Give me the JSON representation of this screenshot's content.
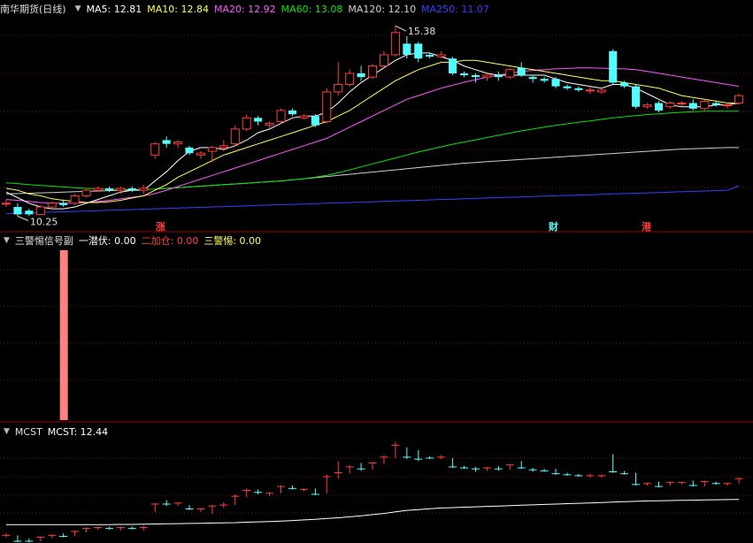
{
  "colors": {
    "up": "#ff3c3c",
    "down": "#54ffff",
    "ma5": "#ffffff",
    "ma10": "#ffff54",
    "ma20": "#ff54ff",
    "ma60": "#00e600",
    "ma120": "#d0d0d0",
    "ma250": "#3c3cff",
    "grid": "#7a0a0a",
    "border": "#a00000",
    "signal": "#ff8080",
    "mcst": "#ffffff"
  },
  "main_legend": {
    "title": "南华期货(日线)",
    "items": [
      {
        "text": "MA5: 12.81",
        "color": "#ffffff"
      },
      {
        "text": "MA10: 12.84",
        "color": "#ffff54"
      },
      {
        "text": "MA20: 12.92",
        "color": "#ff54ff"
      },
      {
        "text": "MA60: 13.08",
        "color": "#00e600"
      },
      {
        "text": "MA120: 12.10",
        "color": "#d0d0d0"
      },
      {
        "text": "MA250: 11.07",
        "color": "#3c3cff"
      }
    ]
  },
  "sub1_legend": {
    "title": "三警惕信号副",
    "items": [
      {
        "text": "一潜伏: 0.00",
        "color": "#ffffff"
      },
      {
        "text": "二加仓: 0.00",
        "color": "#ff3c3c"
      },
      {
        "text": "三警惕: 0.00",
        "color": "#ffff54"
      }
    ]
  },
  "sub2_legend": {
    "title": "MCST",
    "items": [
      {
        "text": "MCST: 12.44",
        "color": "#ffffff"
      }
    ]
  },
  "markers": {
    "zhang": "涨",
    "cai": "财",
    "gang": "港"
  },
  "annotations": {
    "high": "15.38",
    "low": "10.25"
  },
  "chart_data": {
    "type": "candlestick",
    "price_range": [
      10.0,
      15.6
    ],
    "candles": [
      [
        10.6,
        10.6,
        10.5,
        10.7
      ],
      [
        10.5,
        10.3,
        10.25,
        10.6
      ],
      [
        10.4,
        10.3,
        10.25,
        10.45
      ],
      [
        10.3,
        10.5,
        10.3,
        10.55
      ],
      [
        10.5,
        10.6,
        10.45,
        10.65
      ],
      [
        10.6,
        10.55,
        10.5,
        10.7
      ],
      [
        10.6,
        10.8,
        10.55,
        10.85
      ],
      [
        10.8,
        10.95,
        10.75,
        11.0
      ],
      [
        10.95,
        11.0,
        10.9,
        11.05
      ],
      [
        11.0,
        10.95,
        10.9,
        11.05
      ],
      [
        10.95,
        11.0,
        10.85,
        11.05
      ],
      [
        11.0,
        10.95,
        10.9,
        11.05
      ],
      [
        10.95,
        11.0,
        10.85,
        11.1
      ],
      [
        11.9,
        12.2,
        11.8,
        12.25
      ],
      [
        12.3,
        12.2,
        12.1,
        12.4
      ],
      [
        12.2,
        12.25,
        12.1,
        12.3
      ],
      [
        12.1,
        11.95,
        11.9,
        12.15
      ],
      [
        11.9,
        11.95,
        11.8,
        12.0
      ],
      [
        12.0,
        12.1,
        11.7,
        12.15
      ],
      [
        12.1,
        12.15,
        12.0,
        12.3
      ],
      [
        12.2,
        12.6,
        12.15,
        12.7
      ],
      [
        12.6,
        12.9,
        12.55,
        13.0
      ],
      [
        12.9,
        12.8,
        12.7,
        12.95
      ],
      [
        12.7,
        12.75,
        12.6,
        12.8
      ],
      [
        12.8,
        13.1,
        12.75,
        13.15
      ],
      [
        13.1,
        13.0,
        12.95,
        13.15
      ],
      [
        12.9,
        12.95,
        12.85,
        13.0
      ],
      [
        12.95,
        12.7,
        12.65,
        13.0
      ],
      [
        12.8,
        13.6,
        12.75,
        13.7
      ],
      [
        13.6,
        13.8,
        13.5,
        14.4
      ],
      [
        13.8,
        14.1,
        13.75,
        14.2
      ],
      [
        14.1,
        14.0,
        13.9,
        14.3
      ],
      [
        14.0,
        14.3,
        13.95,
        14.35
      ],
      [
        14.3,
        14.6,
        14.25,
        14.7
      ],
      [
        14.6,
        15.2,
        14.55,
        15.38
      ],
      [
        14.9,
        14.6,
        14.5,
        15.1
      ],
      [
        14.9,
        14.5,
        14.4,
        14.95
      ],
      [
        14.6,
        14.55,
        14.5,
        14.65
      ],
      [
        14.55,
        14.6,
        14.5,
        14.7
      ],
      [
        14.5,
        14.1,
        14.05,
        14.55
      ],
      [
        14.1,
        14.05,
        14.0,
        14.15
      ],
      [
        14.05,
        14.0,
        13.85,
        14.1
      ],
      [
        14.0,
        14.05,
        13.9,
        14.1
      ],
      [
        14.05,
        14.0,
        13.9,
        14.15
      ],
      [
        14.0,
        14.2,
        13.95,
        14.25
      ],
      [
        14.25,
        14.05,
        14.0,
        14.4
      ],
      [
        14.0,
        13.95,
        13.85,
        14.05
      ],
      [
        13.95,
        13.9,
        13.85,
        14.0
      ],
      [
        13.95,
        13.75,
        13.7,
        14.0
      ],
      [
        13.75,
        13.7,
        13.65,
        13.8
      ],
      [
        13.7,
        13.65,
        13.6,
        13.75
      ],
      [
        13.65,
        13.65,
        13.55,
        13.75
      ],
      [
        13.6,
        13.65,
        13.55,
        13.7
      ],
      [
        14.7,
        13.85,
        13.8,
        14.75
      ],
      [
        13.85,
        13.75,
        13.7,
        13.9
      ],
      [
        13.75,
        13.2,
        13.15,
        13.8
      ],
      [
        13.2,
        13.25,
        13.15,
        13.3
      ],
      [
        13.3,
        13.1,
        13.05,
        13.35
      ],
      [
        13.2,
        13.3,
        13.15,
        13.35
      ],
      [
        13.3,
        13.3,
        13.2,
        13.35
      ],
      [
        13.3,
        13.15,
        13.1,
        13.4
      ],
      [
        13.15,
        13.35,
        13.1,
        13.4
      ],
      [
        13.3,
        13.25,
        13.2,
        13.35
      ],
      [
        13.25,
        13.25,
        13.15,
        13.3
      ],
      [
        13.3,
        13.5,
        13.25,
        13.55
      ]
    ],
    "ma": {
      "ma5": [
        10.9,
        10.75,
        10.6,
        10.5,
        10.45,
        10.45,
        10.5,
        10.6,
        10.7,
        10.8,
        10.9,
        10.95,
        10.95,
        11.2,
        11.45,
        11.75,
        12.0,
        12.1,
        12.1,
        12.05,
        12.15,
        12.3,
        12.5,
        12.6,
        12.75,
        12.9,
        12.95,
        12.95,
        13.05,
        13.3,
        13.6,
        13.85,
        14.05,
        14.25,
        14.45,
        14.6,
        14.65,
        14.65,
        14.55,
        14.45,
        14.3,
        14.2,
        14.1,
        14.05,
        14.05,
        14.05,
        14.05,
        14.05,
        13.95,
        13.85,
        13.8,
        13.75,
        13.7,
        13.8,
        13.8,
        13.7,
        13.55,
        13.4,
        13.25,
        13.2,
        13.2,
        13.2,
        13.25,
        13.25,
        13.3
      ],
      "ma10": [
        11.0,
        10.95,
        10.85,
        10.8,
        10.72,
        10.68,
        10.65,
        10.62,
        10.62,
        10.64,
        10.68,
        10.74,
        10.8,
        10.95,
        11.1,
        11.3,
        11.45,
        11.6,
        11.75,
        11.9,
        12.0,
        12.1,
        12.2,
        12.3,
        12.4,
        12.5,
        12.6,
        12.7,
        12.8,
        12.95,
        13.1,
        13.3,
        13.5,
        13.7,
        13.9,
        14.05,
        14.2,
        14.3,
        14.4,
        14.4,
        14.45,
        14.45,
        14.4,
        14.35,
        14.3,
        14.25,
        14.2,
        14.15,
        14.1,
        14.05,
        14.0,
        13.95,
        13.9,
        13.9,
        13.85,
        13.8,
        13.75,
        13.7,
        13.6,
        13.5,
        13.45,
        13.4,
        13.35,
        13.3,
        13.3
      ],
      "ma20": [
        10.7,
        10.68,
        10.65,
        10.62,
        10.6,
        10.6,
        10.6,
        10.62,
        10.65,
        10.68,
        10.72,
        10.76,
        10.8,
        10.86,
        10.95,
        11.05,
        11.15,
        11.25,
        11.35,
        11.45,
        11.55,
        11.65,
        11.75,
        11.85,
        11.95,
        12.05,
        12.15,
        12.25,
        12.35,
        12.5,
        12.65,
        12.8,
        12.95,
        13.1,
        13.25,
        13.4,
        13.5,
        13.6,
        13.7,
        13.78,
        13.86,
        13.93,
        14.0,
        14.05,
        14.1,
        14.15,
        14.18,
        14.2,
        14.22,
        14.23,
        14.25,
        14.25,
        14.24,
        14.23,
        14.22,
        14.2,
        14.15,
        14.1,
        14.05,
        14.0,
        13.95,
        13.9,
        13.85,
        13.8,
        13.75
      ],
      "ma60": [
        11.15,
        11.13,
        11.1,
        11.08,
        11.06,
        11.04,
        11.02,
        11.0,
        10.99,
        10.98,
        10.97,
        10.97,
        10.97,
        10.98,
        11.0,
        11.02,
        11.04,
        11.06,
        11.08,
        11.1,
        11.12,
        11.14,
        11.16,
        11.18,
        11.2,
        11.23,
        11.26,
        11.3,
        11.35,
        11.42,
        11.5,
        11.58,
        11.66,
        11.74,
        11.82,
        11.9,
        11.98,
        12.05,
        12.12,
        12.19,
        12.25,
        12.31,
        12.37,
        12.43,
        12.49,
        12.55,
        12.6,
        12.65,
        12.7,
        12.74,
        12.78,
        12.82,
        12.86,
        12.9,
        12.93,
        12.96,
        12.99,
        13.01,
        13.03,
        13.05,
        13.07,
        13.08,
        13.08,
        13.08,
        13.08
      ],
      "ma120": [
        10.85,
        10.86,
        10.87,
        10.88,
        10.89,
        10.9,
        10.91,
        10.92,
        10.93,
        10.94,
        10.95,
        10.96,
        10.97,
        10.98,
        11.0,
        11.02,
        11.04,
        11.06,
        11.08,
        11.1,
        11.12,
        11.14,
        11.16,
        11.18,
        11.2,
        11.23,
        11.26,
        11.29,
        11.32,
        11.35,
        11.38,
        11.41,
        11.44,
        11.47,
        11.5,
        11.53,
        11.56,
        11.59,
        11.62,
        11.65,
        11.68,
        11.7,
        11.72,
        11.74,
        11.76,
        11.78,
        11.8,
        11.82,
        11.84,
        11.86,
        11.88,
        11.9,
        11.92,
        11.94,
        11.96,
        11.98,
        12.0,
        12.02,
        12.04,
        12.06,
        12.07,
        12.08,
        12.09,
        12.1,
        12.1
      ],
      "ma250": [
        10.32,
        10.33,
        10.34,
        10.35,
        10.36,
        10.37,
        10.38,
        10.39,
        10.4,
        10.41,
        10.42,
        10.43,
        10.44,
        10.45,
        10.46,
        10.47,
        10.48,
        10.49,
        10.5,
        10.51,
        10.52,
        10.53,
        10.54,
        10.55,
        10.56,
        10.57,
        10.58,
        10.59,
        10.6,
        10.61,
        10.62,
        10.63,
        10.64,
        10.65,
        10.66,
        10.67,
        10.68,
        10.69,
        10.7,
        10.71,
        10.72,
        10.73,
        10.74,
        10.75,
        10.76,
        10.77,
        10.78,
        10.79,
        10.8,
        10.81,
        10.82,
        10.83,
        10.84,
        10.85,
        10.86,
        10.87,
        10.88,
        10.89,
        10.9,
        10.91,
        10.92,
        10.93,
        10.94,
        10.95,
        11.07
      ]
    },
    "signal_bar_index": 5,
    "mcst_values": [
      11.15,
      11.15,
      11.15,
      11.15,
      11.15,
      11.15,
      11.15,
      11.15,
      11.15,
      11.15,
      11.16,
      11.16,
      11.17,
      11.18,
      11.19,
      11.2,
      11.21,
      11.22,
      11.23,
      11.24,
      11.25,
      11.27,
      11.29,
      11.31,
      11.33,
      11.36,
      11.39,
      11.42,
      11.46,
      11.5,
      11.55,
      11.6,
      11.66,
      11.72,
      11.8,
      11.88,
      11.92,
      11.96,
      12.0,
      12.02,
      12.04,
      12.06,
      12.08,
      12.1,
      12.12,
      12.14,
      12.16,
      12.18,
      12.2,
      12.22,
      12.24,
      12.26,
      12.28,
      12.3,
      12.32,
      12.34,
      12.36,
      12.37,
      12.38,
      12.39,
      12.4,
      12.41,
      12.42,
      12.43,
      12.44
    ]
  }
}
